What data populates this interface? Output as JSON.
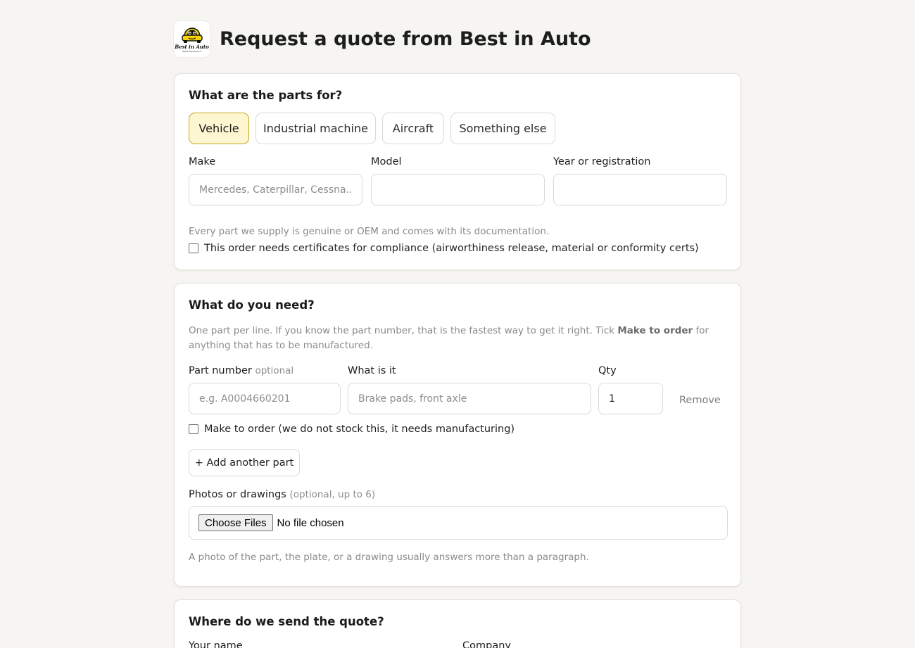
{
  "header": {
    "title": "Request a quote from Best in Auto",
    "logo_text": "Best in Auto",
    "logo_subtext": "Spare Trading LLC"
  },
  "parts_for": {
    "title": "What are the parts for?",
    "options": [
      {
        "label": "Vehicle",
        "selected": true
      },
      {
        "label": "Industrial machine",
        "selected": false
      },
      {
        "label": "Aircraft",
        "selected": false
      },
      {
        "label": "Something else",
        "selected": false
      }
    ],
    "make_label": "Make",
    "make_placeholder": "Mercedes, Caterpillar, Cessna...",
    "make_value": "",
    "model_label": "Model",
    "model_value": "",
    "year_label": "Year or registration",
    "year_value": "",
    "note": "Every part we supply is genuine or OEM and comes with its documentation.",
    "certs_label": "This order needs certificates for compliance (airworthiness release, material or conformity certs)",
    "certs_checked": false
  },
  "needs": {
    "title": "What do you need?",
    "help_pre": "One part per line. If you know the part number, that is the fastest way to get it right. Tick ",
    "help_bold": "Make to order",
    "help_post": " for anything that has to be manufactured.",
    "part_number_label": "Part number",
    "part_number_optional": "optional",
    "part_number_placeholder": "e.g. A0004660201",
    "what_label": "What is it",
    "what_placeholder": "Brake pads, front axle",
    "qty_label": "Qty",
    "qty_value": "1",
    "remove_label": "Remove",
    "make_to_order_label": "Make to order (we do not stock this, it needs manufacturing)",
    "make_to_order_checked": false,
    "add_part_label": "+ Add another part",
    "photos_label": "Photos or drawings",
    "photos_optional": "(optional, up to 6)",
    "choose_files_label": "Choose Files",
    "no_file_label": "No file chosen",
    "photos_help": "A photo of the part, the plate, or a drawing usually answers more than a paragraph."
  },
  "send": {
    "title": "Where do we send the quote?",
    "name_label": "Your name",
    "company_label": "Company"
  },
  "colors": {
    "accent": "#c6a620",
    "selected_bg": "#fdf6d0",
    "page_bg": "#f6f5f2",
    "logo_yellow": "#f5d20a"
  }
}
